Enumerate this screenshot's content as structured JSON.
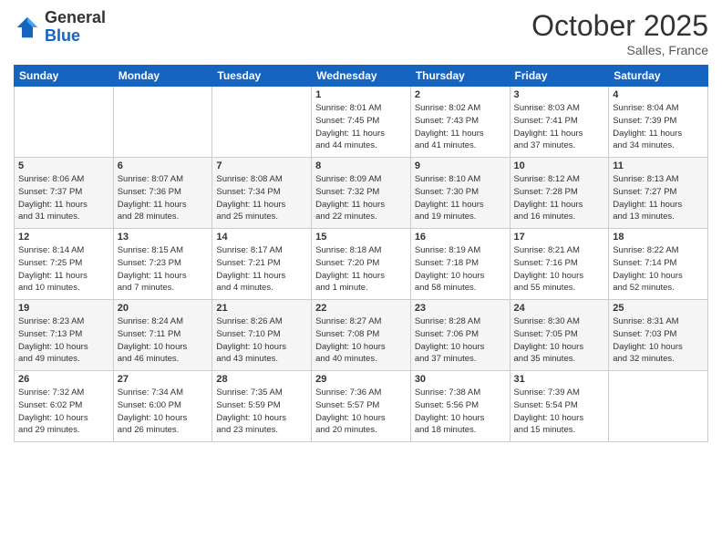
{
  "header": {
    "logo_general": "General",
    "logo_blue": "Blue",
    "month": "October 2025",
    "location": "Salles, France"
  },
  "days": [
    "Sunday",
    "Monday",
    "Tuesday",
    "Wednesday",
    "Thursday",
    "Friday",
    "Saturday"
  ],
  "weeks": [
    [
      {
        "day": "",
        "info": ""
      },
      {
        "day": "",
        "info": ""
      },
      {
        "day": "",
        "info": ""
      },
      {
        "day": "1",
        "info": "Sunrise: 8:01 AM\nSunset: 7:45 PM\nDaylight: 11 hours\nand 44 minutes."
      },
      {
        "day": "2",
        "info": "Sunrise: 8:02 AM\nSunset: 7:43 PM\nDaylight: 11 hours\nand 41 minutes."
      },
      {
        "day": "3",
        "info": "Sunrise: 8:03 AM\nSunset: 7:41 PM\nDaylight: 11 hours\nand 37 minutes."
      },
      {
        "day": "4",
        "info": "Sunrise: 8:04 AM\nSunset: 7:39 PM\nDaylight: 11 hours\nand 34 minutes."
      }
    ],
    [
      {
        "day": "5",
        "info": "Sunrise: 8:06 AM\nSunset: 7:37 PM\nDaylight: 11 hours\nand 31 minutes."
      },
      {
        "day": "6",
        "info": "Sunrise: 8:07 AM\nSunset: 7:36 PM\nDaylight: 11 hours\nand 28 minutes."
      },
      {
        "day": "7",
        "info": "Sunrise: 8:08 AM\nSunset: 7:34 PM\nDaylight: 11 hours\nand 25 minutes."
      },
      {
        "day": "8",
        "info": "Sunrise: 8:09 AM\nSunset: 7:32 PM\nDaylight: 11 hours\nand 22 minutes."
      },
      {
        "day": "9",
        "info": "Sunrise: 8:10 AM\nSunset: 7:30 PM\nDaylight: 11 hours\nand 19 minutes."
      },
      {
        "day": "10",
        "info": "Sunrise: 8:12 AM\nSunset: 7:28 PM\nDaylight: 11 hours\nand 16 minutes."
      },
      {
        "day": "11",
        "info": "Sunrise: 8:13 AM\nSunset: 7:27 PM\nDaylight: 11 hours\nand 13 minutes."
      }
    ],
    [
      {
        "day": "12",
        "info": "Sunrise: 8:14 AM\nSunset: 7:25 PM\nDaylight: 11 hours\nand 10 minutes."
      },
      {
        "day": "13",
        "info": "Sunrise: 8:15 AM\nSunset: 7:23 PM\nDaylight: 11 hours\nand 7 minutes."
      },
      {
        "day": "14",
        "info": "Sunrise: 8:17 AM\nSunset: 7:21 PM\nDaylight: 11 hours\nand 4 minutes."
      },
      {
        "day": "15",
        "info": "Sunrise: 8:18 AM\nSunset: 7:20 PM\nDaylight: 11 hours\nand 1 minute."
      },
      {
        "day": "16",
        "info": "Sunrise: 8:19 AM\nSunset: 7:18 PM\nDaylight: 10 hours\nand 58 minutes."
      },
      {
        "day": "17",
        "info": "Sunrise: 8:21 AM\nSunset: 7:16 PM\nDaylight: 10 hours\nand 55 minutes."
      },
      {
        "day": "18",
        "info": "Sunrise: 8:22 AM\nSunset: 7:14 PM\nDaylight: 10 hours\nand 52 minutes."
      }
    ],
    [
      {
        "day": "19",
        "info": "Sunrise: 8:23 AM\nSunset: 7:13 PM\nDaylight: 10 hours\nand 49 minutes."
      },
      {
        "day": "20",
        "info": "Sunrise: 8:24 AM\nSunset: 7:11 PM\nDaylight: 10 hours\nand 46 minutes."
      },
      {
        "day": "21",
        "info": "Sunrise: 8:26 AM\nSunset: 7:10 PM\nDaylight: 10 hours\nand 43 minutes."
      },
      {
        "day": "22",
        "info": "Sunrise: 8:27 AM\nSunset: 7:08 PM\nDaylight: 10 hours\nand 40 minutes."
      },
      {
        "day": "23",
        "info": "Sunrise: 8:28 AM\nSunset: 7:06 PM\nDaylight: 10 hours\nand 37 minutes."
      },
      {
        "day": "24",
        "info": "Sunrise: 8:30 AM\nSunset: 7:05 PM\nDaylight: 10 hours\nand 35 minutes."
      },
      {
        "day": "25",
        "info": "Sunrise: 8:31 AM\nSunset: 7:03 PM\nDaylight: 10 hours\nand 32 minutes."
      }
    ],
    [
      {
        "day": "26",
        "info": "Sunrise: 7:32 AM\nSunset: 6:02 PM\nDaylight: 10 hours\nand 29 minutes."
      },
      {
        "day": "27",
        "info": "Sunrise: 7:34 AM\nSunset: 6:00 PM\nDaylight: 10 hours\nand 26 minutes."
      },
      {
        "day": "28",
        "info": "Sunrise: 7:35 AM\nSunset: 5:59 PM\nDaylight: 10 hours\nand 23 minutes."
      },
      {
        "day": "29",
        "info": "Sunrise: 7:36 AM\nSunset: 5:57 PM\nDaylight: 10 hours\nand 20 minutes."
      },
      {
        "day": "30",
        "info": "Sunrise: 7:38 AM\nSunset: 5:56 PM\nDaylight: 10 hours\nand 18 minutes."
      },
      {
        "day": "31",
        "info": "Sunrise: 7:39 AM\nSunset: 5:54 PM\nDaylight: 10 hours\nand 15 minutes."
      },
      {
        "day": "",
        "info": ""
      }
    ]
  ]
}
